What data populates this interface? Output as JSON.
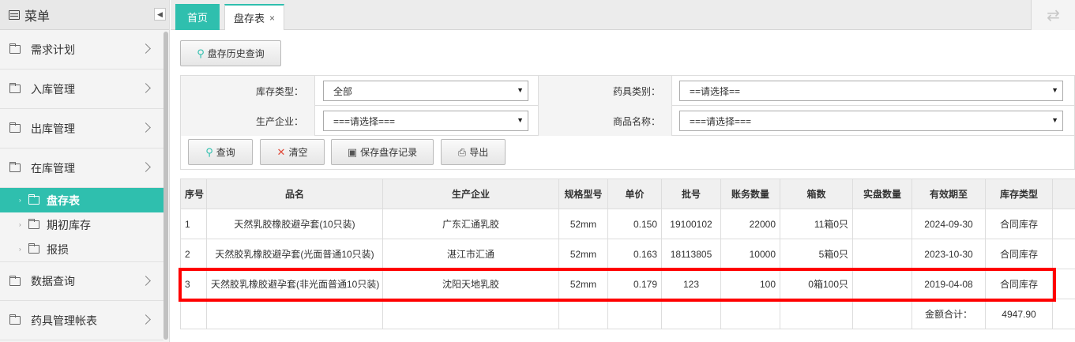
{
  "sidebar": {
    "title": "菜单",
    "collapse_icon": "◀",
    "items": [
      {
        "label": "需求计划"
      },
      {
        "label": "入库管理"
      },
      {
        "label": "出库管理"
      },
      {
        "label": "在库管理"
      },
      {
        "label": "数据查询"
      },
      {
        "label": "药具管理帐表"
      }
    ],
    "sub_items": [
      {
        "label": "盘存表",
        "active": true
      },
      {
        "label": "期初库存"
      },
      {
        "label": "报损"
      }
    ]
  },
  "tabs": {
    "home": "首页",
    "active": "盘存表",
    "close": "×"
  },
  "toolbar": {
    "history_btn": "盘存历史查询"
  },
  "filters": {
    "stock_type_label": "库存类型：",
    "stock_type_value": "全部",
    "category_label": "药具类别：",
    "category_value": "==请选择==",
    "manufacturer_label": "生产企业：",
    "manufacturer_value": "===请选择===",
    "product_label": "商品名称：",
    "product_value": "===请选择==="
  },
  "actions": {
    "query": "查询",
    "clear": "清空",
    "save": "保存盘存记录",
    "export": "导出"
  },
  "table": {
    "headers": [
      "序号",
      "品名",
      "生产企业",
      "规格型号",
      "单价",
      "批号",
      "账务数量",
      "箱数",
      "实盘数量",
      "有效期至",
      "库存类型"
    ],
    "rows": [
      [
        "1",
        "天然乳胶橡胶避孕套(10只装)",
        "广东汇通乳胶",
        "52mm",
        "0.150",
        "19100102",
        "22000",
        "11箱0只",
        "",
        "2024-09-30",
        "合同库存"
      ],
      [
        "2",
        "天然胶乳橡胶避孕套(光面普通10只装)",
        "湛江市汇通",
        "52mm",
        "0.163",
        "18113805",
        "10000",
        "5箱0只",
        "",
        "2023-10-30",
        "合同库存"
      ],
      [
        "3",
        "天然胶乳橡胶避孕套(非光面普通10只装)",
        "沈阳天地乳胶",
        "52mm",
        "0.179",
        "123",
        "100",
        "0箱100只",
        "",
        "2019-04-08",
        "合同库存"
      ]
    ],
    "total_label": "金额合计：",
    "total_value": "4947.90"
  },
  "colors": {
    "accent": "#2fbfae",
    "highlight": "#ff0000"
  }
}
